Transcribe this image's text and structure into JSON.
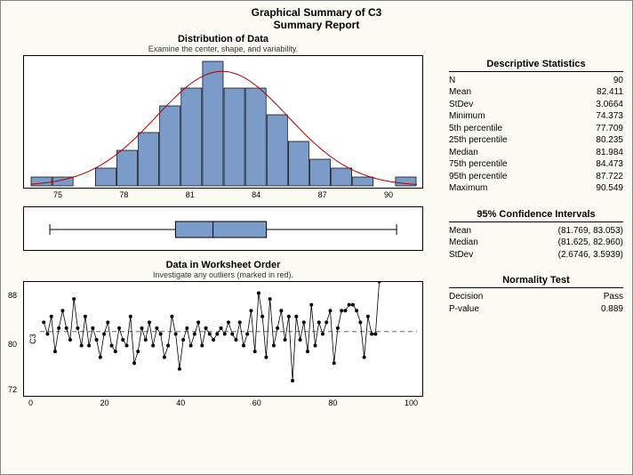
{
  "title_line1": "Graphical Summary of C3",
  "title_line2": "Summary Report",
  "dist_title": "Distribution of Data",
  "dist_sub": "Examine the center, shape, and variability.",
  "run_title": "Data in Worksheet Order",
  "run_sub": "Investigate any outliers (marked in red).",
  "y_axis_label": "C3",
  "desc_title": "Descriptive Statistics",
  "ci_title": "95% Confidence Intervals",
  "norm_title": "Normality Test",
  "desc": {
    "N_label": "N",
    "N_val": "90",
    "Mean_label": "Mean",
    "Mean_val": "82.411",
    "StDev_label": "StDev",
    "StDev_val": "3.0664",
    "Min_label": "Minimum",
    "Min_val": "74.373",
    "p5_label": "5th percentile",
    "p5_val": "77.709",
    "p25_label": "25th percentile",
    "p25_val": "80.235",
    "Median_label": "Median",
    "Median_val": "81.984",
    "p75_label": "75th percentile",
    "p75_val": "84.473",
    "p95_label": "95th percentile",
    "p95_val": "87.722",
    "Max_label": "Maximum",
    "Max_val": "90.549"
  },
  "ci": {
    "Mean_label": "Mean",
    "Mean_val": "(81.769, 83.053)",
    "Median_label": "Median",
    "Median_val": "(81.625, 82.960)",
    "StDev_label": "StDev",
    "StDev_val": "(2.6746, 3.5939)"
  },
  "norm": {
    "Decision_label": "Decision",
    "Decision_val": "Pass",
    "P_label": "P-value",
    "P_val": "0.889"
  },
  "hist_xticks": [
    "75",
    "78",
    "81",
    "84",
    "87",
    "90"
  ],
  "run_xticks": [
    "0",
    "20",
    "40",
    "60",
    "80",
    "100"
  ],
  "run_yticks": [
    "72",
    "80",
    "88"
  ],
  "chart_data": {
    "histogram": {
      "type": "bar",
      "bin_centers": [
        74,
        75,
        76,
        77,
        78,
        79,
        80,
        81,
        82,
        83,
        84,
        85,
        86,
        87,
        88,
        89,
        90,
        91
      ],
      "counts": [
        1,
        1,
        0,
        2,
        4,
        6,
        9,
        11,
        14,
        11,
        11,
        8,
        5,
        3,
        2,
        1,
        0,
        1
      ],
      "xlim": [
        73.5,
        91.5
      ],
      "overlay": "normal-curve",
      "title": "Distribution of Data"
    },
    "boxplot": {
      "type": "boxplot",
      "whisker_low": 74.373,
      "q1": 80.235,
      "median": 81.984,
      "q3": 84.473,
      "whisker_high": 90.549,
      "xlim": [
        73.5,
        91.5
      ]
    },
    "runchart": {
      "type": "line",
      "x_range": [
        1,
        90
      ],
      "ylim": [
        72,
        90
      ],
      "center_line": 82.411,
      "title": "Data in Worksheet Order",
      "ylabel": "C3",
      "values": [
        84,
        82,
        85,
        79,
        83,
        86,
        83,
        81,
        88,
        83,
        80,
        85,
        80,
        83,
        81,
        78,
        82,
        84,
        80,
        79,
        83,
        81,
        80,
        85,
        77,
        79,
        83,
        81,
        84,
        80,
        83,
        82,
        78,
        80,
        85,
        82,
        76,
        81,
        83,
        80,
        82,
        84,
        80,
        83,
        82,
        81,
        82,
        83,
        82,
        84,
        82,
        81,
        84,
        80,
        82,
        86,
        79,
        89,
        85,
        78,
        88,
        80,
        83,
        86,
        81,
        85,
        74,
        85,
        81,
        84,
        79,
        87,
        80,
        84,
        82,
        84,
        86,
        77,
        83,
        86,
        86,
        87,
        87,
        86,
        84,
        78,
        85,
        82,
        82,
        91
      ]
    }
  }
}
